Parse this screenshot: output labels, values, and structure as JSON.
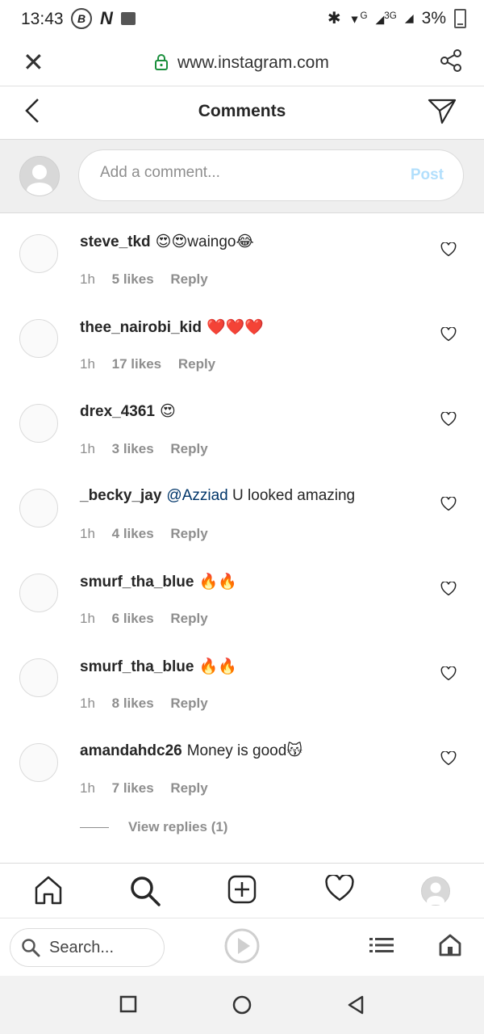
{
  "status_bar": {
    "time": "13:43",
    "network": "3G",
    "wifi_label": "G",
    "battery": "3%"
  },
  "browser": {
    "url": "www.instagram.com"
  },
  "header": {
    "title": "Comments"
  },
  "compose": {
    "placeholder": "Add a comment...",
    "post_label": "Post"
  },
  "comments": [
    {
      "username": "steve_tkd",
      "text": "😍😍waingo😂",
      "mention": "",
      "time": "1h",
      "likes": "5 likes",
      "reply": "Reply"
    },
    {
      "username": "thee_nairobi_kid",
      "text": "❤️❤️❤️",
      "mention": "",
      "time": "1h",
      "likes": "17 likes",
      "reply": "Reply"
    },
    {
      "username": "drex_4361",
      "text": "😍",
      "mention": "",
      "time": "1h",
      "likes": "3 likes",
      "reply": "Reply"
    },
    {
      "username": "_becky_jay",
      "text": "U looked amazing",
      "mention": "@Azziad",
      "time": "1h",
      "likes": "4 likes",
      "reply": "Reply"
    },
    {
      "username": "smurf_tha_blue",
      "text": "🔥🔥",
      "mention": "",
      "time": "1h",
      "likes": "6 likes",
      "reply": "Reply"
    },
    {
      "username": "smurf_tha_blue",
      "text": "🔥🔥",
      "mention": "",
      "time": "1h",
      "likes": "8 likes",
      "reply": "Reply"
    },
    {
      "username": "amandahdc26",
      "text": "Money is good😽",
      "mention": "",
      "time": "1h",
      "likes": "7 likes",
      "reply": "Reply"
    }
  ],
  "view_replies": "View replies (1)",
  "ig_nav": [
    "home-icon",
    "search-icon",
    "new-post-icon",
    "activity-heart-icon",
    "profile-avatar"
  ],
  "browser_bottom": {
    "search_label": "Search..."
  },
  "colors": {
    "post_disabled": "#b2dffc",
    "mention": "#003569",
    "secure_lock": "#1a8f3c"
  }
}
